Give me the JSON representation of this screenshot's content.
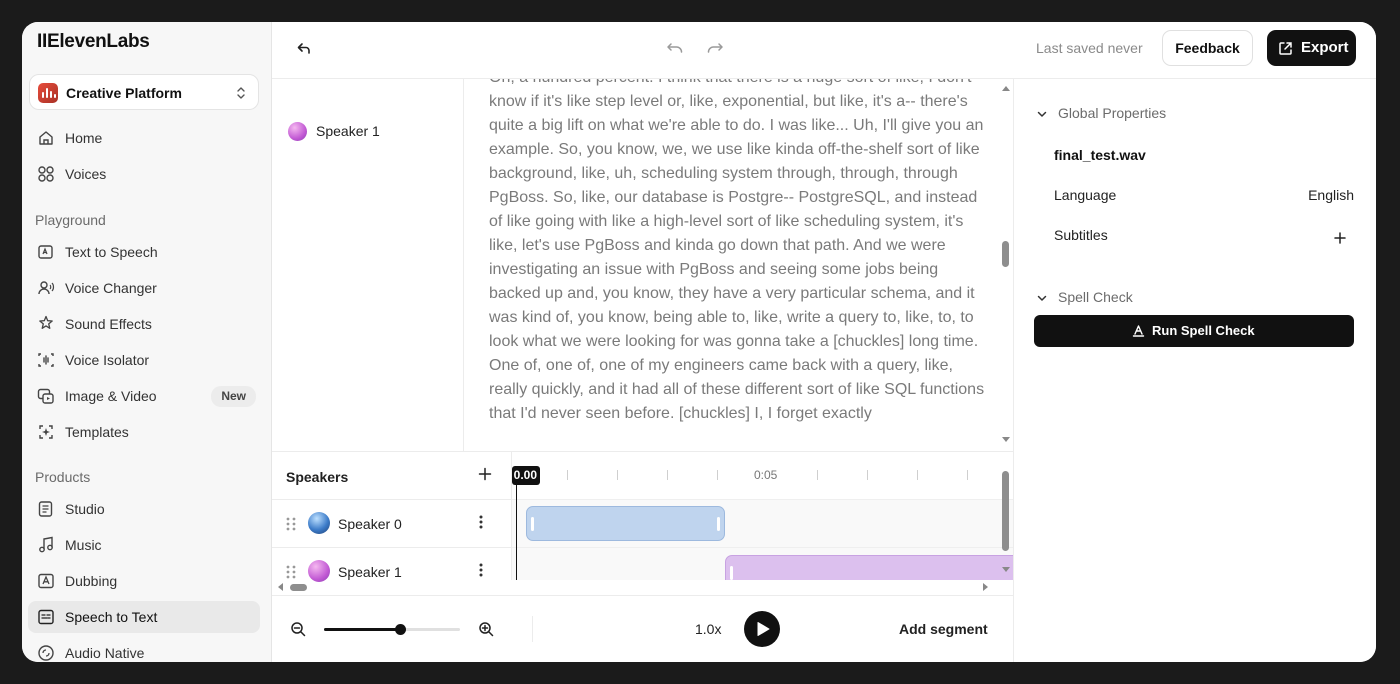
{
  "app": {
    "logo": "IIElevenLabs"
  },
  "workspace": {
    "label": "Creative Platform",
    "icon": "eleven-audio-icon"
  },
  "nav": {
    "top": [
      {
        "label": "Home",
        "icon": "home-icon"
      },
      {
        "label": "Voices",
        "icon": "voices-icon"
      }
    ],
    "playground_heading": "Playground",
    "playground": [
      {
        "label": "Text to Speech",
        "icon": "text-to-speech-icon"
      },
      {
        "label": "Voice Changer",
        "icon": "voice-changer-icon"
      },
      {
        "label": "Sound Effects",
        "icon": "sound-effects-icon"
      },
      {
        "label": "Voice Isolator",
        "icon": "voice-isolator-icon"
      },
      {
        "label": "Image & Video",
        "icon": "image-video-icon",
        "badge": "New"
      },
      {
        "label": "Templates",
        "icon": "templates-icon"
      }
    ],
    "products_heading": "Products",
    "products": [
      {
        "label": "Studio",
        "icon": "studio-icon"
      },
      {
        "label": "Music",
        "icon": "music-icon"
      },
      {
        "label": "Dubbing",
        "icon": "dubbing-icon"
      },
      {
        "label": "Speech to Text",
        "icon": "speech-to-text-icon",
        "active": true
      },
      {
        "label": "Audio Native",
        "icon": "audio-native-icon"
      }
    ]
  },
  "topbar": {
    "saved_status": "Last saved never",
    "feedback_label": "Feedback",
    "export_label": "Export"
  },
  "transcript": {
    "speaker": "Speaker 1",
    "text": "Oh, a hundred percent. I think that there is a huge sort of like, I don't know if it's like step level or, like, exponential, but like, it's a-- there's quite a big lift on what we're able to do. I was like... Uh, I'll give you an example. So, you know, we, we use like kinda off-the-shelf sort of like background, like, uh, scheduling system through, through, through PgBoss. So, like, our database is Postgre-- PostgreSQL, and instead of like going with like a high-level sort of like scheduling system, it's like, let's use PgBoss and kinda go down that path. And we were investigating an issue with PgBoss and seeing some jobs being backed up and, you know, they have a very particular schema, and it was kind of, you know, being able to, like, write a query to, like, to, to look what we were looking for was gonna take a [chuckles] long time. One of, one of, one of my engineers came back with a query, like, really quickly, and it had all of these different sort of like SQL functions that I'd never seen before. [chuckles] I, I forget exactly"
  },
  "timeline": {
    "heading": "Speakers",
    "playhead_label": "0.00",
    "time_labels": [
      "0:05"
    ],
    "speakers": [
      {
        "name": "Speaker 0",
        "color": "#bfd4ee",
        "border": "#9db9de"
      },
      {
        "name": "Speaker 1",
        "color": "#dcc0ee",
        "border": "#c8a2e2"
      }
    ]
  },
  "controls": {
    "zoom_level": 0.56,
    "speed": "1.0x",
    "add_segment": "Add segment"
  },
  "properties": {
    "global_heading": "Global Properties",
    "filename": "final_test.wav",
    "language_label": "Language",
    "language_value": "English",
    "subtitles_label": "Subtitles",
    "spell_heading": "Spell Check",
    "spell_button": "Run Spell Check"
  }
}
